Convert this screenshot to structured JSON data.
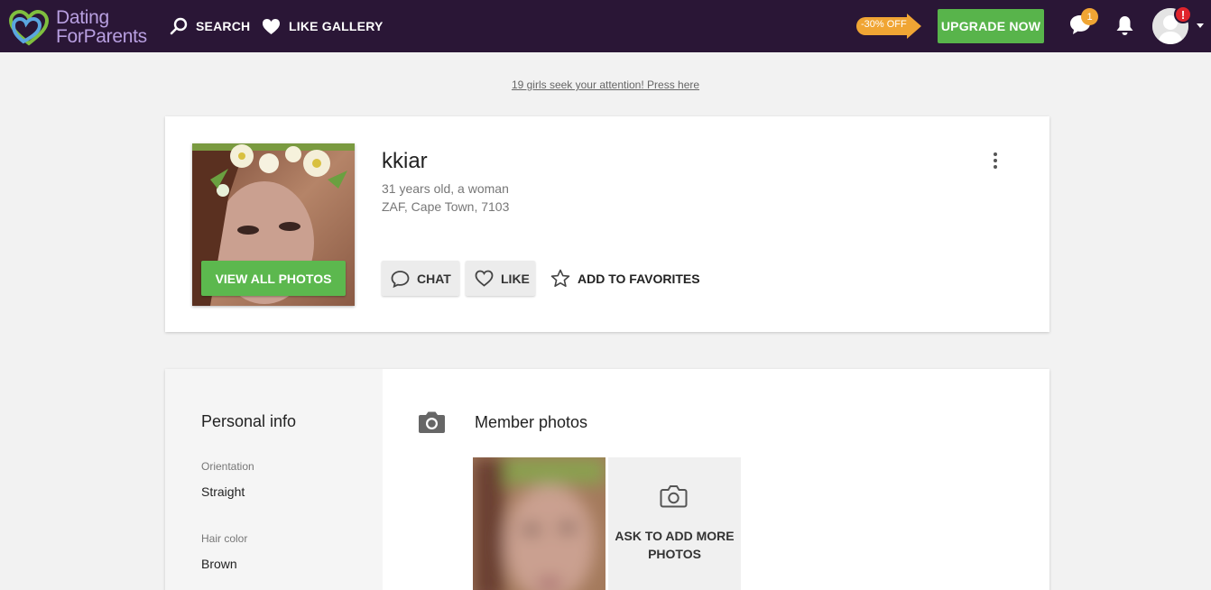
{
  "header": {
    "logo_line1": "Dating",
    "logo_line2": "ForParents",
    "nav": [
      {
        "label": "SEARCH",
        "icon": "search-icon"
      },
      {
        "label": "LIKE GALLERY",
        "icon": "heart-icon"
      }
    ],
    "discount": "-30% OFF",
    "upgrade_label": "UPGRADE NOW",
    "messages_count": "1",
    "profile_alert": "!",
    "colors": {
      "bar": "#2a1636",
      "accent_green": "#58b44b",
      "badge_orange": "#f0a534",
      "alert_red": "#e0242c"
    }
  },
  "promo": "19 girls seek your attention! Press here",
  "profile": {
    "username": "kkiar",
    "age_gender": "31 years old, a woman",
    "location": "ZAF, Cape Town, 7103",
    "view_photos_label": "VIEW ALL PHOTOS",
    "chat_label": "CHAT",
    "like_label": "LIKE",
    "favorites_label": "ADD TO FAVORITES"
  },
  "personal_info": {
    "title": "Personal info",
    "fields": [
      {
        "label": "Orientation",
        "value": "Straight"
      },
      {
        "label": "Hair color",
        "value": "Brown"
      }
    ]
  },
  "member_photos": {
    "title": "Member photos",
    "ask_more_line1": "ASK TO ADD MORE",
    "ask_more_line2": "PHOTOS"
  }
}
